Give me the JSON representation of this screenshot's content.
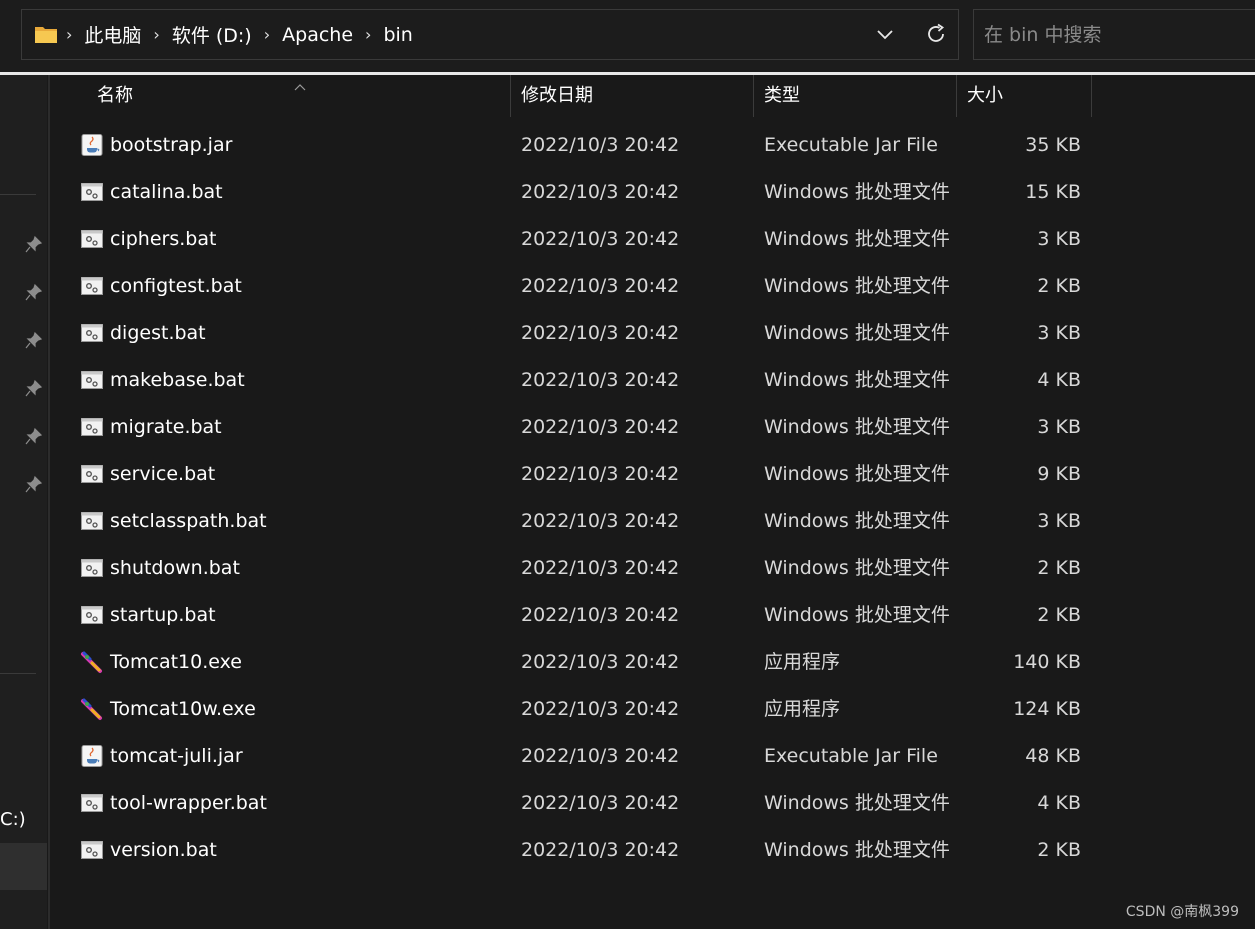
{
  "address_bar": {
    "breadcrumbs": [
      "此电脑",
      "软件 (D:)",
      "Apache",
      "bin"
    ]
  },
  "search": {
    "placeholder": "在 bin 中搜索"
  },
  "columns": {
    "name": "名称",
    "date": "修改日期",
    "type": "类型",
    "size": "大小"
  },
  "nav": {
    "drive_label": "C:)"
  },
  "files": [
    {
      "name": "bootstrap.jar",
      "date": "2022/10/3 20:42",
      "type": "Executable Jar File",
      "size": "35 KB",
      "icon": "jar-icon"
    },
    {
      "name": "catalina.bat",
      "date": "2022/10/3 20:42",
      "type": "Windows 批处理文件",
      "size": "15 KB",
      "icon": "bat-icon"
    },
    {
      "name": "ciphers.bat",
      "date": "2022/10/3 20:42",
      "type": "Windows 批处理文件",
      "size": "3 KB",
      "icon": "bat-icon"
    },
    {
      "name": "configtest.bat",
      "date": "2022/10/3 20:42",
      "type": "Windows 批处理文件",
      "size": "2 KB",
      "icon": "bat-icon"
    },
    {
      "name": "digest.bat",
      "date": "2022/10/3 20:42",
      "type": "Windows 批处理文件",
      "size": "3 KB",
      "icon": "bat-icon"
    },
    {
      "name": "makebase.bat",
      "date": "2022/10/3 20:42",
      "type": "Windows 批处理文件",
      "size": "4 KB",
      "icon": "bat-icon"
    },
    {
      "name": "migrate.bat",
      "date": "2022/10/3 20:42",
      "type": "Windows 批处理文件",
      "size": "3 KB",
      "icon": "bat-icon"
    },
    {
      "name": "service.bat",
      "date": "2022/10/3 20:42",
      "type": "Windows 批处理文件",
      "size": "9 KB",
      "icon": "bat-icon"
    },
    {
      "name": "setclasspath.bat",
      "date": "2022/10/3 20:42",
      "type": "Windows 批处理文件",
      "size": "3 KB",
      "icon": "bat-icon"
    },
    {
      "name": "shutdown.bat",
      "date": "2022/10/3 20:42",
      "type": "Windows 批处理文件",
      "size": "2 KB",
      "icon": "bat-icon"
    },
    {
      "name": "startup.bat",
      "date": "2022/10/3 20:42",
      "type": "Windows 批处理文件",
      "size": "2 KB",
      "icon": "bat-icon"
    },
    {
      "name": "Tomcat10.exe",
      "date": "2022/10/3 20:42",
      "type": "应用程序",
      "size": "140 KB",
      "icon": "tomcat-exe-icon"
    },
    {
      "name": "Tomcat10w.exe",
      "date": "2022/10/3 20:42",
      "type": "应用程序",
      "size": "124 KB",
      "icon": "tomcat-exe-icon"
    },
    {
      "name": "tomcat-juli.jar",
      "date": "2022/10/3 20:42",
      "type": "Executable Jar File",
      "size": "48 KB",
      "icon": "jar-icon"
    },
    {
      "name": "tool-wrapper.bat",
      "date": "2022/10/3 20:42",
      "type": "Windows 批处理文件",
      "size": "4 KB",
      "icon": "bat-icon"
    },
    {
      "name": "version.bat",
      "date": "2022/10/3 20:42",
      "type": "Windows 批处理文件",
      "size": "2 KB",
      "icon": "bat-icon"
    }
  ],
  "watermark": "CSDN @南枫399",
  "colors": {
    "background": "#191919",
    "text": "#ffffff",
    "folder": "#f4c24a"
  }
}
